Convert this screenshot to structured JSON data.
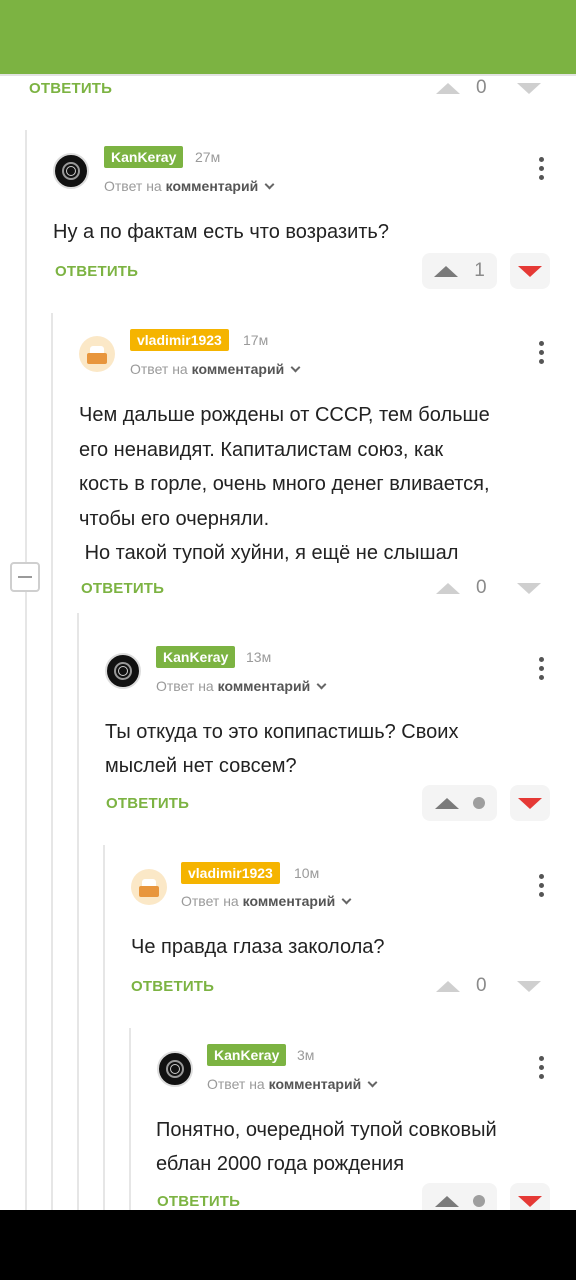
{
  "top_reply": {
    "reply_label": "ОТВЕТИТЬ",
    "count": "0"
  },
  "comments": [
    {
      "username": "KanKeray",
      "time": "27м",
      "meta_prefix": "Ответ на",
      "meta_link": "комментарий",
      "text": "Ну а по фактам есть что возразить?",
      "reply_label": "ОТВЕТИТЬ",
      "count": "1"
    },
    {
      "username": "vladimir1923",
      "time": "17м",
      "meta_prefix": "Ответ на",
      "meta_link": "комментарий",
      "text": "Чем дальше рождены от СССР, тем больше\nего ненавидят. Капиталистам союз, как\nкость в горле, очень много денег вливается,\nчтобы его очерняли.\n Но такой тупой хуйни, я ещё не слышал",
      "reply_label": "ОТВЕТИТЬ",
      "count": "0"
    },
    {
      "username": "KanKeray",
      "time": "13м",
      "meta_prefix": "Ответ на",
      "meta_link": "комментарий",
      "text": "Ты откуда то это копипастишь? Своих\nмыслей нет совсем?",
      "reply_label": "ОТВЕТИТЬ",
      "count": ""
    },
    {
      "username": "vladimir1923",
      "time": "10м",
      "meta_prefix": "Ответ на",
      "meta_link": "комментарий",
      "text": "Че правда глаза заколола?",
      "reply_label": "ОТВЕТИТЬ",
      "count": "0"
    },
    {
      "username": "KanKeray",
      "time": "3м",
      "meta_prefix": "Ответ на",
      "meta_link": "комментарий",
      "text": "Понятно, очередной тупой совковый\nеблан 2000 года рождения",
      "reply_label": "ОТВЕТИТЬ",
      "count": ""
    }
  ],
  "colors": {
    "accent": "#7cb342",
    "gold_badge": "#f5b400",
    "downvote": "#e53935"
  },
  "icons": [
    "collapse-icon",
    "upvote-icon",
    "downvote-icon",
    "more-icon",
    "chevron-down-icon"
  ]
}
